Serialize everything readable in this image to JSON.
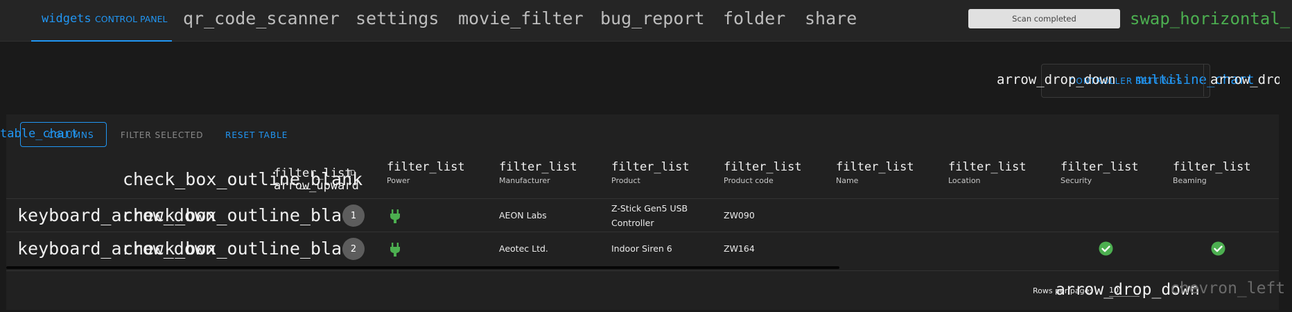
{
  "nav": {
    "active": {
      "icon": "widgets",
      "label": "CONTROL PANEL"
    },
    "tabs": [
      {
        "icon": "qr_code_scanner"
      },
      {
        "icon": "settings"
      },
      {
        "icon": "movie_filter"
      },
      {
        "icon": "bug_report"
      },
      {
        "icon": "folder"
      },
      {
        "icon": "share"
      }
    ],
    "status": "Scan completed",
    "status_icon": "swap_horizontal_",
    "status_icon_color": "#4caf50",
    "accent": "#2196f3"
  },
  "controller": {
    "dropdown_icon": "arrow_drop_down",
    "label": "CONTROLLER SETTINGS",
    "multi_icon": "multiline_chart",
    "dropdown_icon_2": "arrow_drop_down"
  },
  "table": {
    "toolbar": {
      "columns_icon": "table_chart",
      "columns_label": "COLUMNS",
      "filter_selected": "FILTER SELECTED",
      "reset_table": "RESET TABLE"
    },
    "header": {
      "checkbox_icon": "check_box_outline_blank",
      "filter_icon": "filter_list",
      "sort_icon": "arrow_upward",
      "id_label": "ID",
      "columns": [
        "Power",
        "Manufacturer",
        "Product",
        "Product code",
        "Name",
        "Location",
        "Security",
        "Beaming"
      ]
    },
    "rows": [
      {
        "expand_icon": "keyboard_arrow_down",
        "checkbox_icon": "check_box_outline_blank",
        "id": "1",
        "power_icon": "power",
        "manufacturer": "AEON Labs",
        "product_line1": "Z-Stick Gen5 USB",
        "product_line2": "Controller",
        "product_code": "ZW090",
        "name": "",
        "location": "",
        "security": false,
        "beaming": false
      },
      {
        "expand_icon": "keyboard_arrow_down",
        "checkbox_icon": "check_box_outline_blank",
        "id": "2",
        "power_icon": "power",
        "manufacturer": "Aeotec Ltd.",
        "product_line1": "Indoor Siren 6",
        "product_line2": "",
        "product_code": "ZW164",
        "name": "",
        "location": "",
        "security": true,
        "beaming": true
      }
    ],
    "footer": {
      "rows_per_page_label": "Rows per page:",
      "rows_per_page_icon": "arrow_drop_down",
      "rows_per_page_value": "10",
      "pager_icons": "chevron_left"
    },
    "ok_color": "#4caf50"
  }
}
